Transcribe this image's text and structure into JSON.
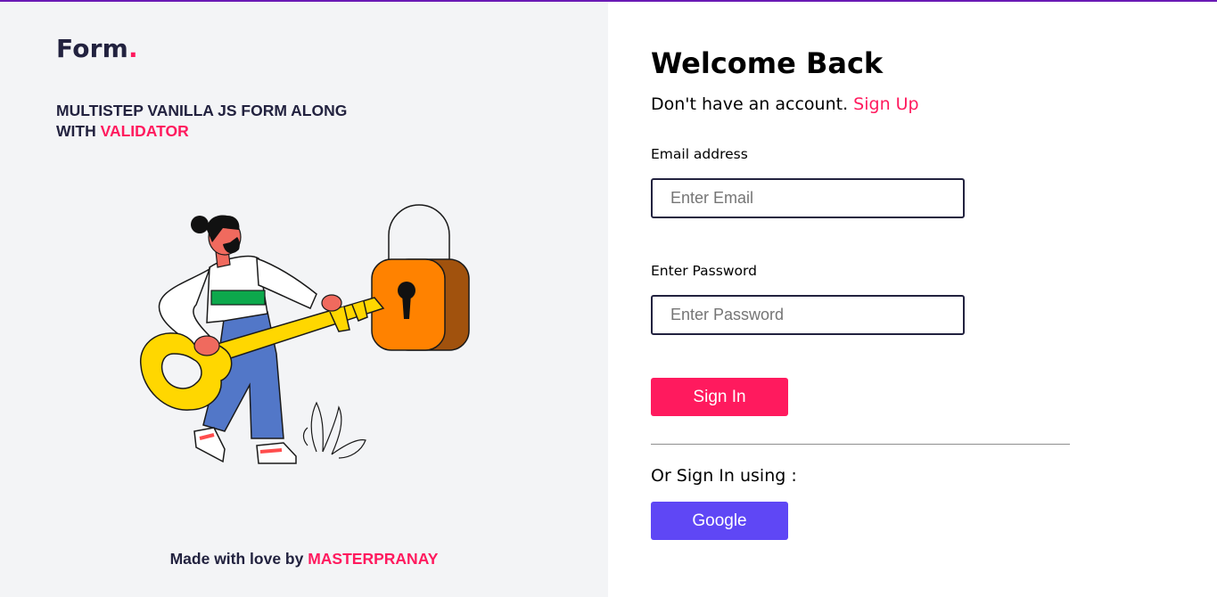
{
  "left_panel": {
    "logo_text": "Form",
    "logo_dot": ".",
    "tagline_part1": "MULTISTEP VANILLA JS FORM ALONG",
    "tagline_part2": "WITH ",
    "tagline_accent": "VALIDATOR",
    "illustration_icon": "person-with-key-and-padlock-illustration",
    "footer_text": "Made with love by ",
    "footer_author": "MASTERPRANAY"
  },
  "form": {
    "title": "Welcome Back",
    "signup_prompt": "Don't have an account. ",
    "signup_link": "Sign Up",
    "email_label": "Email address",
    "email_placeholder": "Enter Email",
    "email_value": "",
    "password_label": "Enter Password",
    "password_placeholder": "Enter Password",
    "password_value": "",
    "signin_button": "Sign In",
    "alt_signin_text": "Or Sign In using :",
    "google_button": "Google"
  },
  "colors": {
    "accent": "#ff1a5e",
    "dark_text": "#22223f",
    "google_button": "#5f47f5",
    "left_panel_bg": "#f3f4f6",
    "top_border": "#6a1ab5"
  }
}
